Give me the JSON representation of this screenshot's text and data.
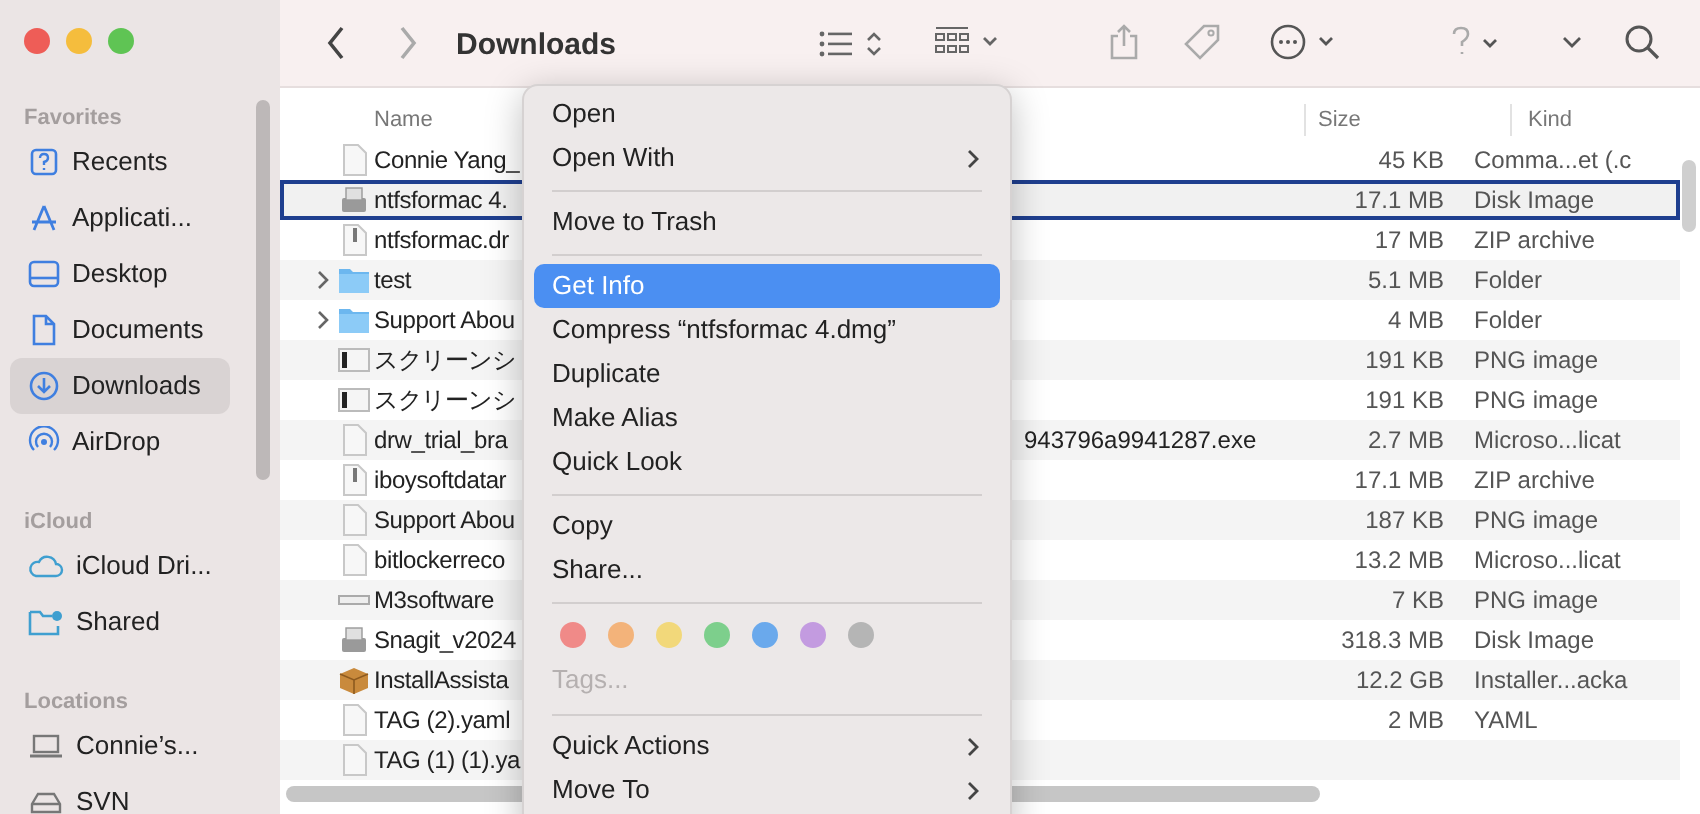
{
  "window": {
    "title": "Downloads"
  },
  "sidebar": {
    "sections": [
      {
        "title": "Favorites",
        "items": [
          {
            "label": "Recents",
            "selected": false
          },
          {
            "label": "Applicati...",
            "selected": false
          },
          {
            "label": "Desktop",
            "selected": false
          },
          {
            "label": "Documents",
            "selected": false
          },
          {
            "label": "Downloads",
            "selected": true
          },
          {
            "label": "AirDrop",
            "selected": false
          }
        ]
      },
      {
        "title": "iCloud",
        "items": [
          {
            "label": "iCloud Dri...",
            "selected": false
          },
          {
            "label": "Shared",
            "selected": false
          }
        ]
      },
      {
        "title": "Locations",
        "items": [
          {
            "label": "Connie’s...",
            "selected": false
          },
          {
            "label": "SVN",
            "selected": false
          }
        ]
      }
    ]
  },
  "table": {
    "columns": [
      "Name",
      "Size",
      "Kind"
    ],
    "rows": [
      {
        "kind": "doc",
        "name": "Connie Yang_",
        "size": "45 KB",
        "type": "Comma...et (.c",
        "selected": false,
        "expandable": false
      },
      {
        "kind": "disk",
        "name": "ntfsformac 4.",
        "size": "17.1 MB",
        "type": "Disk Image",
        "selected": true,
        "expandable": false
      },
      {
        "kind": "zip",
        "name": "ntfsformac.dr",
        "size": "17 MB",
        "type": "ZIP archive",
        "selected": false,
        "expandable": false
      },
      {
        "kind": "folder",
        "name": "test",
        "size": "5.1 MB",
        "type": "Folder",
        "selected": false,
        "expandable": true
      },
      {
        "kind": "folder",
        "name": "Support Abou",
        "size": "4 MB",
        "type": "Folder",
        "selected": false,
        "expandable": true
      },
      {
        "kind": "image",
        "name": "スクリーンシ",
        "size": "191 KB",
        "type": "PNG image",
        "selected": false,
        "expandable": false
      },
      {
        "kind": "image",
        "name": "スクリーンシ",
        "size": "191 KB",
        "type": "PNG image",
        "selected": false,
        "expandable": false
      },
      {
        "kind": "doc",
        "name": "drw_trial_bra",
        "name_tail": "943796a9941287.exe",
        "size": "2.7 MB",
        "type": "Microso...licat",
        "selected": false,
        "expandable": false
      },
      {
        "kind": "zip",
        "name": "iboysoftdatar",
        "size": "17.1 MB",
        "type": "ZIP archive",
        "selected": false,
        "expandable": false
      },
      {
        "kind": "doc",
        "name": "Support Abou",
        "size": "187 KB",
        "type": "PNG image",
        "selected": false,
        "expandable": false
      },
      {
        "kind": "doc",
        "name": "bitlockerreco",
        "size": "13.2 MB",
        "type": "Microso...licat",
        "selected": false,
        "expandable": false
      },
      {
        "kind": "strip",
        "name": "M3software",
        "size": "7 KB",
        "type": "PNG image",
        "selected": false,
        "expandable": false
      },
      {
        "kind": "disk",
        "name": "Snagit_v2024",
        "size": "318.3 MB",
        "type": "Disk Image",
        "selected": false,
        "expandable": false
      },
      {
        "kind": "package",
        "name": "InstallAssista",
        "size": "12.2 GB",
        "type": "Installer...acka",
        "selected": false,
        "expandable": false
      },
      {
        "kind": "doc",
        "name": "TAG (2).yaml",
        "size": "2 MB",
        "type": "YAML",
        "selected": false,
        "expandable": false
      },
      {
        "kind": "doc",
        "name": "TAG (1) (1).ya",
        "selected": false,
        "expandable": false
      }
    ]
  },
  "context_menu": {
    "items": [
      {
        "kind": "item",
        "label": "Open",
        "selected": false,
        "submenu": false
      },
      {
        "kind": "item",
        "label": "Open With",
        "selected": false,
        "submenu": true
      },
      {
        "kind": "separator"
      },
      {
        "kind": "item",
        "label": "Move to Trash",
        "selected": false,
        "submenu": false
      },
      {
        "kind": "separator"
      },
      {
        "kind": "item",
        "label": "Get Info",
        "selected": true,
        "submenu": false
      },
      {
        "kind": "item",
        "label": "Compress “ntfsformac 4.dmg”",
        "selected": false,
        "submenu": false
      },
      {
        "kind": "item",
        "label": "Duplicate",
        "selected": false,
        "submenu": false
      },
      {
        "kind": "item",
        "label": "Make Alias",
        "selected": false,
        "submenu": false
      },
      {
        "kind": "item",
        "label": "Quick Look",
        "selected": false,
        "submenu": false
      },
      {
        "kind": "separator"
      },
      {
        "kind": "item",
        "label": "Copy",
        "selected": false,
        "submenu": false
      },
      {
        "kind": "item",
        "label": "Share...",
        "selected": false,
        "submenu": false
      },
      {
        "kind": "separator"
      },
      {
        "kind": "tags",
        "colors": [
          {
            "color": "#f08a88"
          },
          {
            "color": "#f3b37a"
          },
          {
            "color": "#f2d87a"
          },
          {
            "color": "#7dcf8c"
          },
          {
            "color": "#6aa9ec"
          },
          {
            "color": "#c39be0"
          },
          {
            "color": "#b5b5b5"
          }
        ]
      },
      {
        "kind": "tag_field",
        "placeholder": "Tags..."
      },
      {
        "kind": "separator"
      },
      {
        "kind": "item",
        "label": "Quick Actions",
        "selected": false,
        "submenu": true
      },
      {
        "kind": "item",
        "label": "Move To",
        "selected": false,
        "submenu": true
      }
    ]
  }
}
